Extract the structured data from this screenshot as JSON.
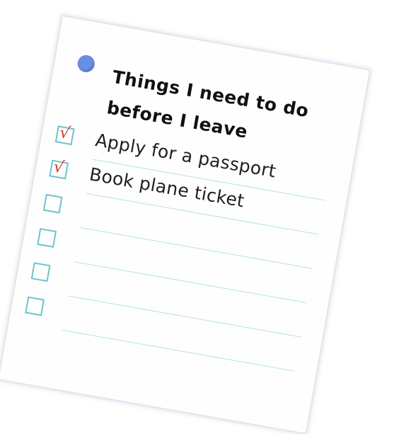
{
  "note": {
    "title": "Things I need to do before I leave",
    "items": [
      {
        "label": "Apply for a passport",
        "checked": true,
        "mark": "√"
      },
      {
        "label": "Book plane ticket",
        "checked": true,
        "mark": "√"
      },
      {
        "label": "",
        "checked": false
      },
      {
        "label": "",
        "checked": false
      },
      {
        "label": "",
        "checked": false
      },
      {
        "label": "",
        "checked": false
      }
    ]
  },
  "colors": {
    "pin": "#6b8fe0",
    "checkbox_border": "#6ec3cc",
    "checkmark": "#d23a22",
    "rule_line": "#b6e2e8"
  }
}
